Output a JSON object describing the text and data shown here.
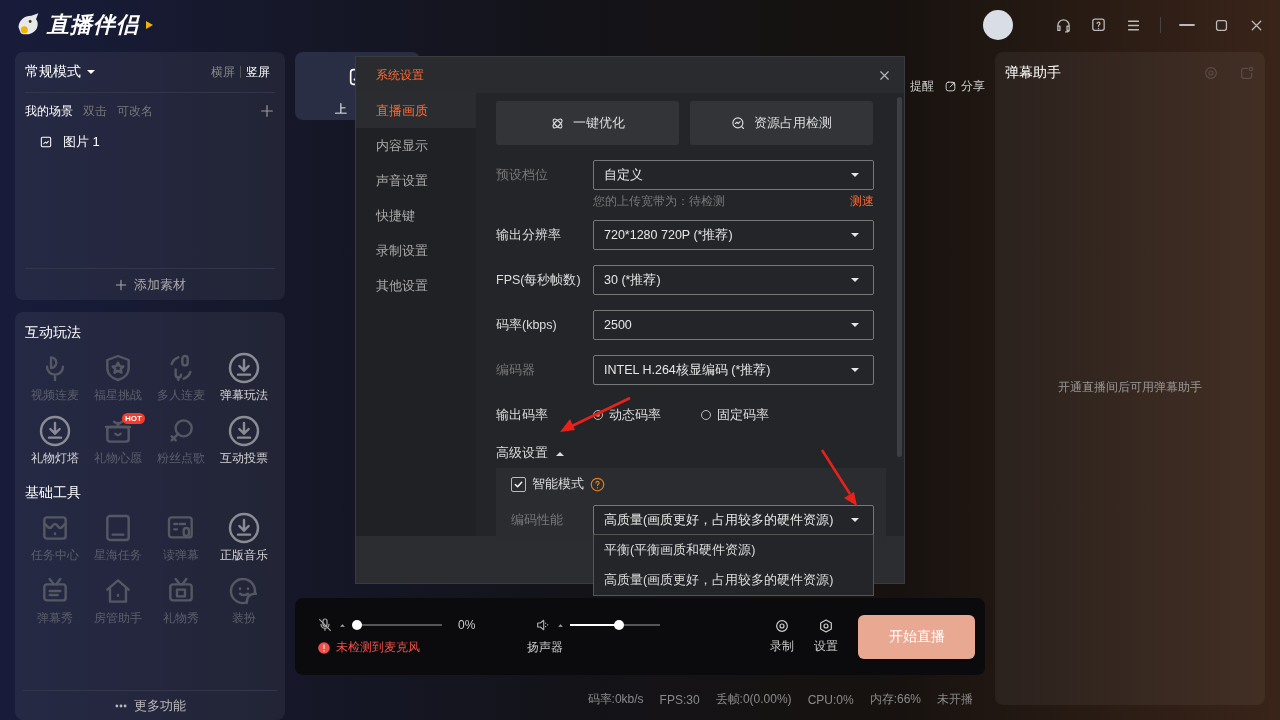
{
  "app": {
    "logo": "直播伴侣"
  },
  "scene_panel": {
    "mode": "常规模式",
    "orientations": [
      {
        "label": "横屏",
        "selected": false
      },
      {
        "label": "竖屏",
        "selected": true
      }
    ],
    "title": "我的场景",
    "hints": [
      "双击",
      "可改名"
    ],
    "scenes": [
      {
        "label": "图片 1"
      }
    ],
    "add_button": "添加素材"
  },
  "interactive": {
    "title": "互动玩法",
    "tools": [
      {
        "label": "视频连麦",
        "download": false
      },
      {
        "label": "福星挑战",
        "download": false
      },
      {
        "label": "多人连麦",
        "download": false
      },
      {
        "label": "弹幕玩法",
        "download": true
      },
      {
        "label": "礼物灯塔",
        "download": true
      },
      {
        "label": "礼物心愿",
        "download": false,
        "badge": "HOT"
      },
      {
        "label": "粉丝点歌",
        "download": false
      },
      {
        "label": "互动投票",
        "download": true
      }
    ]
  },
  "basic": {
    "title": "基础工具",
    "tools": [
      {
        "label": "任务中心",
        "download": false
      },
      {
        "label": "星海任务",
        "download": false
      },
      {
        "label": "读弹幕",
        "download": false
      },
      {
        "label": "正版音乐",
        "download": true
      },
      {
        "label": "弹幕秀",
        "download": false
      },
      {
        "label": "房管助手",
        "download": false
      },
      {
        "label": "礼物秀",
        "download": false
      },
      {
        "label": "装扮",
        "download": false
      }
    ]
  },
  "more_button": "更多功能",
  "center": {
    "source_tab": "上",
    "header_links": [
      "提醒",
      "分享"
    ]
  },
  "audio": {
    "mic": {
      "muted": true,
      "level": 0,
      "reading": "0%",
      "warning": "未检测到麦克风"
    },
    "speaker": {
      "label": "扬声器",
      "level": 0.55
    }
  },
  "actions": [
    "录制",
    "设置"
  ],
  "start_button": "开始直播",
  "status_bar": [
    "码率:0kb/s",
    "FPS:30",
    "丢帧:0(0.00%)",
    "CPU:0%",
    "内存:66%",
    "未开播"
  ],
  "danmaku": {
    "title": "弹幕助手",
    "message": "开通直播间后可用弹幕助手"
  },
  "dialog": {
    "title": "系统设置",
    "nav": [
      {
        "label": "直播画质",
        "selected": true
      },
      {
        "label": "内容显示",
        "selected": false
      },
      {
        "label": "声音设置",
        "selected": false
      },
      {
        "label": "快捷键",
        "selected": false
      },
      {
        "label": "录制设置",
        "selected": false
      },
      {
        "label": "其他设置",
        "selected": false
      }
    ],
    "buttons": [
      "一键优化",
      "资源占用检测"
    ],
    "fields": [
      {
        "label": "预设档位",
        "value": "自定义",
        "disabled": true,
        "hint": "您的上传宽带为：待检测",
        "hint_link": "测速"
      },
      {
        "label": "输出分辨率",
        "value": "720*1280 720P (*推荐)",
        "disabled": false
      },
      {
        "label": "FPS(每秒帧数)",
        "value": "30 (*推荐)",
        "disabled": false
      },
      {
        "label": "码率(kbps)",
        "value": "2500",
        "disabled": false
      },
      {
        "label": "编码器",
        "value": "INTEL H.264核显编码 (*推荐)",
        "disabled": true
      }
    ],
    "bitrate_mode": {
      "label": "输出码率",
      "options": [
        {
          "label": "动态码率",
          "selected": true
        },
        {
          "label": "固定码率",
          "selected": false
        }
      ]
    },
    "advanced": {
      "label": "高级设置",
      "expanded": true,
      "smart_mode": {
        "label": "智能模式",
        "checked": true
      },
      "encode_perf": {
        "label": "编码性能",
        "disabled": true,
        "value": "高质量(画质更好，占用较多的硬件资源)",
        "open": true,
        "options": [
          "平衡(平衡画质和硬件资源)",
          "高质量(画质更好，占用较多的硬件资源)"
        ]
      }
    }
  }
}
